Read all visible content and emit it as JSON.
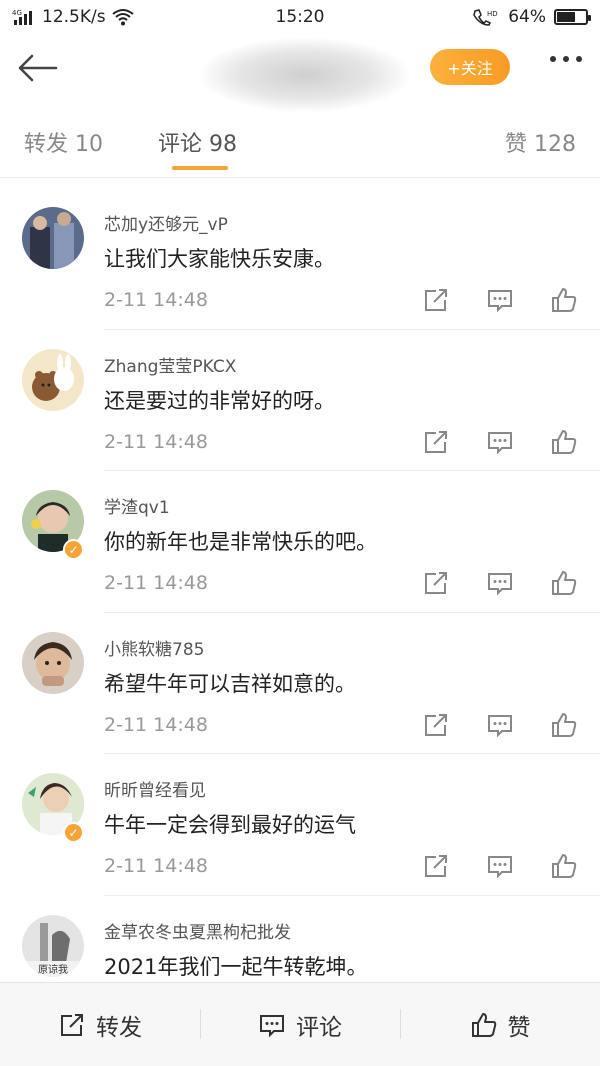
{
  "status_bar": {
    "network": "4G",
    "speed": "12.5K/s",
    "time": "15:20",
    "hd_label": "HD",
    "battery": "64%",
    "battery_level": 0.64
  },
  "nav": {
    "follow_label": "+关注"
  },
  "tabs": {
    "repost": "转发 10",
    "comments": "评论 98",
    "likes": "赞 128"
  },
  "comments": [
    {
      "user": "芯加y还够元_vP",
      "text": "让我们大家能快乐安康。",
      "time": "2-11 14:48",
      "verified": false
    },
    {
      "user": "Zhang莹莹PKCX",
      "text": "还是要过的非常好的呀。",
      "time": "2-11 14:48",
      "verified": false
    },
    {
      "user": "学渣qv1",
      "text": "你的新年也是非常快乐的吧。",
      "time": "2-11 14:48",
      "verified": true
    },
    {
      "user": "小熊软糖785",
      "text": "希望牛年可以吉祥如意的。",
      "time": "2-11 14:48",
      "verified": false
    },
    {
      "user": "昕昕曾经看见",
      "text": "牛年一定会得到最好的运气",
      "time": "2-11 14:48",
      "verified": true
    },
    {
      "user": "金草农冬虫夏黑枸杞批发",
      "text": "2021年我们一起牛转乾坤。",
      "time": "",
      "verified": false,
      "avatar_caption": "原谅我"
    }
  ],
  "bottom_bar": {
    "repost": "转发",
    "comment": "评论",
    "like": "赞"
  },
  "colors": {
    "accent": "#f7a335",
    "follow_button": "#f99b24",
    "secondary_text": "#999999"
  }
}
